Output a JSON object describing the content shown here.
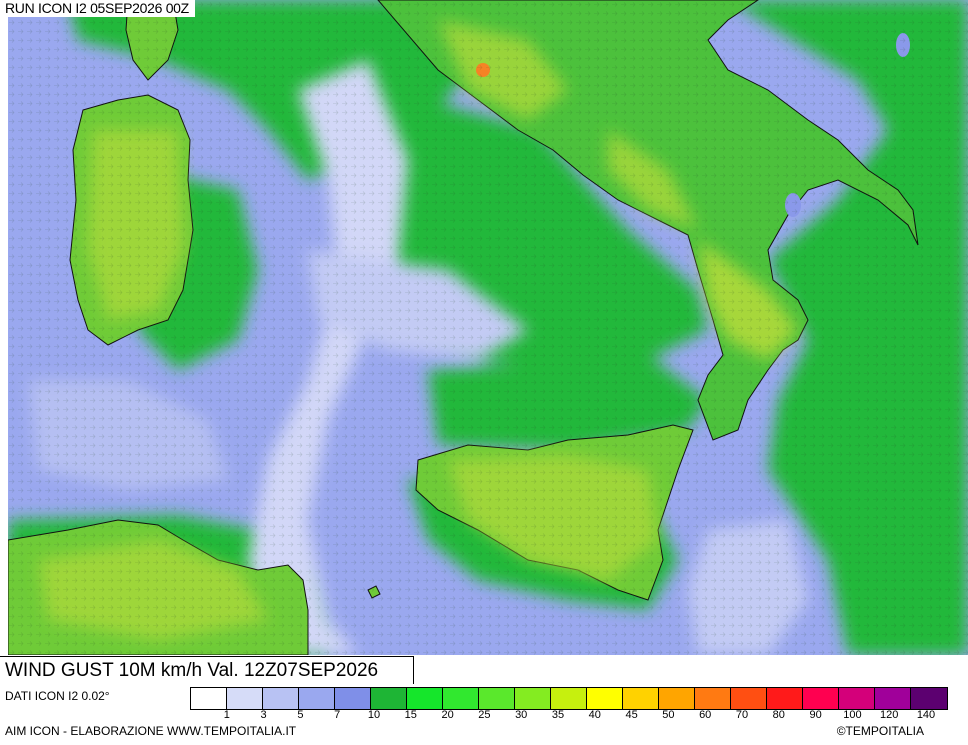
{
  "run_label": "RUN ICON I2 05SEP2026 00Z",
  "title": "WIND GUST 10M km/h Val. 12Z07SEP2026",
  "data_source": "DATI ICON I2 0.02°",
  "credit": "AIM ICON - ELABORAZIONE WWW.TEMPOITALIA.IT",
  "copyright": "TEMPOITALIA",
  "legend": {
    "colors": [
      "#ffffff",
      "#d6dcf8",
      "#b8c2f3",
      "#9aa8ef",
      "#7f8fe8",
      "#1eb535",
      "#15e62b",
      "#31e82f",
      "#5ae82c",
      "#84ec21",
      "#c6f00e",
      "#ffff00",
      "#ffd200",
      "#ffa500",
      "#ff7a12",
      "#ff4f12",
      "#ff1a1a",
      "#ff0050",
      "#d4007a",
      "#a0009a",
      "#5c0070"
    ],
    "ticks": [
      "1",
      "3",
      "5",
      "7",
      "10",
      "15",
      "20",
      "25",
      "30",
      "35",
      "40",
      "45",
      "50",
      "60",
      "70",
      "80",
      "90",
      "100",
      "120",
      "140"
    ]
  },
  "map_colors": {
    "sea_calm": "#b6bef0",
    "sea_light": "#9aa8ef",
    "sea_mid": "#7f8fe8",
    "sea_breeze": "#1eb535",
    "land": "#3fbf3a",
    "land_wind": "#8ed43a",
    "land_gust": "#c9dd3a",
    "hot_spot": "#ff6a2a"
  }
}
